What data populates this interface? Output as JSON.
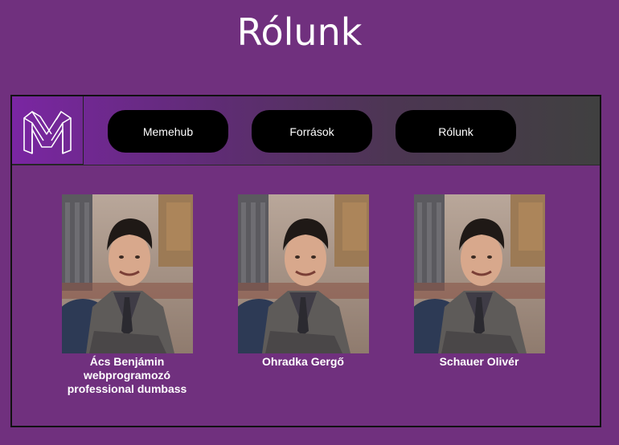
{
  "page": {
    "title": "Rólunk"
  },
  "colors": {
    "background": "#70307e",
    "nav_gradient_start": "#7a26a2",
    "nav_gradient_end": "#404040",
    "button": "#000000",
    "text": "#ffffff"
  },
  "logo": {
    "icon": "memehub-m-logo-icon"
  },
  "nav": {
    "items": [
      {
        "label": "Memehub"
      },
      {
        "label": "Források"
      },
      {
        "label": "Rólunk"
      }
    ]
  },
  "team": {
    "members": [
      {
        "name": "Ács Benjámin",
        "lines": [
          "webprogramozó",
          "professional dumbass"
        ],
        "photo_icon": "member-photo"
      },
      {
        "name": "Ohradka Gergő",
        "lines": [],
        "photo_icon": "member-photo"
      },
      {
        "name": "Schauer Olivér",
        "lines": [],
        "photo_icon": "member-photo"
      }
    ]
  }
}
